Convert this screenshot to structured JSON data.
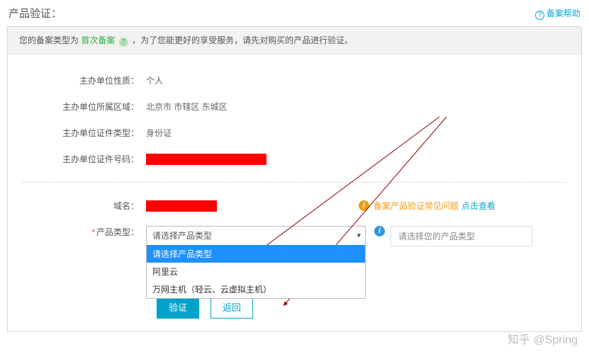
{
  "header": {
    "title": "产品验证：",
    "help_label": "备案帮助"
  },
  "infobar": {
    "prefix": "您的备案类型为",
    "highlight": "首次备案",
    "suffix": "，为了您能更好的享受服务，请先对购买的产品进行验证。"
  },
  "fields": {
    "nature": {
      "label": "主办单位性质：",
      "value": "个人"
    },
    "region": {
      "label": "主办单位所属区域：",
      "value": "北京市 市辖区 东城区"
    },
    "id_type": {
      "label": "主办单位证件类型：",
      "value": "身份证"
    },
    "id_no": {
      "label": "主办单位证件号码："
    },
    "domain": {
      "label": "域名："
    },
    "product_type": {
      "label": "产品类型：",
      "placeholder": "请选择产品类型"
    }
  },
  "dropdown": {
    "options": [
      "请选择产品类型",
      "阿里云",
      "万网主机（轻云、云虚拟主机）"
    ],
    "selected_index": 0
  },
  "faq": {
    "text": "备案产品验证常见问题",
    "link": "点击查看"
  },
  "hint": {
    "text": "请选择您的产品类型"
  },
  "buttons": {
    "verify": "验证",
    "back": "返回"
  },
  "watermark": "知乎 @Spring"
}
